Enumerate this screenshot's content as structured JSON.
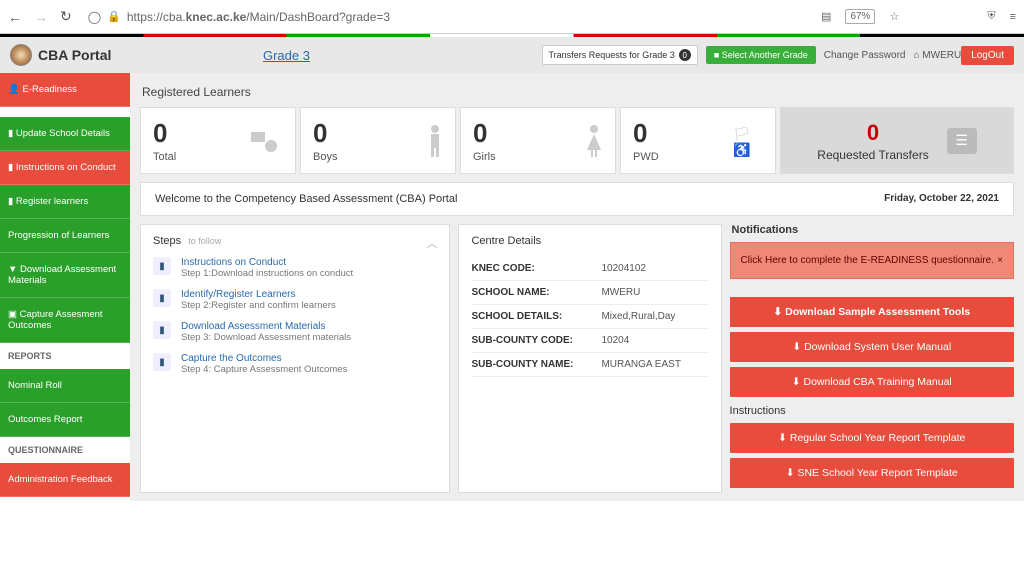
{
  "browser": {
    "url_prefix": "https://cba.",
    "url_bold": "knec.ac.ke",
    "url_suffix": "/Main/DashBoard?grade=3",
    "zoom": "67%"
  },
  "topbar": {
    "app_title": "CBA Portal",
    "grade_link": "Grade 3",
    "transfers_req": "Transfers Requests for Grade 3",
    "transfers_badge": "0",
    "select_another": "Select Another Grade",
    "change_pw": "Change Password",
    "user": "MWERU",
    "logout": "LogOut"
  },
  "sidebar": {
    "items": [
      {
        "label": "E-Readiness",
        "cls": "side-red"
      },
      {
        "label": "",
        "cls": "side-white"
      },
      {
        "label": "Update School Details",
        "cls": "side-green"
      },
      {
        "label": "Instructions on Conduct",
        "cls": "side-red"
      },
      {
        "label": "Register learners",
        "cls": "side-green"
      },
      {
        "label": "Progression of Learners",
        "cls": "side-green"
      },
      {
        "label": "Download Assessment Materials",
        "cls": "side-green"
      },
      {
        "label": "Capture Assesment Outcomes",
        "cls": "side-green"
      }
    ],
    "reports_head": "REPORTS",
    "reports": [
      {
        "label": "Nominal Roll",
        "cls": "side-green"
      },
      {
        "label": "Outcomes Report",
        "cls": "side-green"
      }
    ],
    "quest_head": "QUESTIONNAIRE",
    "quests": [
      {
        "label": "Administration Feedback",
        "cls": "side-red"
      }
    ]
  },
  "registered_title": "Registered Learners",
  "stats": {
    "total": {
      "num": "0",
      "lbl": "Total"
    },
    "boys": {
      "num": "0",
      "lbl": "Boys"
    },
    "girls": {
      "num": "0",
      "lbl": "Girls"
    },
    "pwd": {
      "num": "0",
      "lbl": "PWD"
    },
    "requested": {
      "num": "0",
      "lbl": "Requested Transfers"
    }
  },
  "welcome": {
    "msg": "Welcome to the Competency Based Assessment (CBA) Portal",
    "date": "Friday, October 22, 2021"
  },
  "steps": {
    "title": "Steps",
    "sub": "to follow",
    "items": [
      {
        "t": "Instructions on Conduct",
        "d": "Step 1:Download instructions on conduct"
      },
      {
        "t": "Identify/Register Learners",
        "d": "Step 2:Register and confirm learners"
      },
      {
        "t": "Download Assessment Materials",
        "d": "Step 3: Download Assessment materials"
      },
      {
        "t": "Capture the Outcomes",
        "d": "Step 4: Capture Assessment Outcomes"
      }
    ]
  },
  "centre": {
    "title": "Centre Details",
    "rows": [
      {
        "k": "KNEC CODE:",
        "v": "10204102"
      },
      {
        "k": "SCHOOL NAME:",
        "v": "MWERU"
      },
      {
        "k": "SCHOOL DETAILS:",
        "v": "Mixed,Rural,Day"
      },
      {
        "k": "SUB-COUNTY CODE:",
        "v": "10204"
      },
      {
        "k": "SUB-COUNTY NAME:",
        "v": "MURANGA EAST"
      }
    ]
  },
  "notif": {
    "title": "Notifications",
    "ereadiness": "Click Here to complete the E-READINESS questionnaire.",
    "close": "×",
    "downloads": [
      "Download Sample Assessment Tools",
      "Download System User Manual",
      "Download CBA Training Manual"
    ],
    "instr_title": "Instructions",
    "templates": [
      "Regular School Year Report Template",
      "SNE School Year Report Template"
    ]
  }
}
